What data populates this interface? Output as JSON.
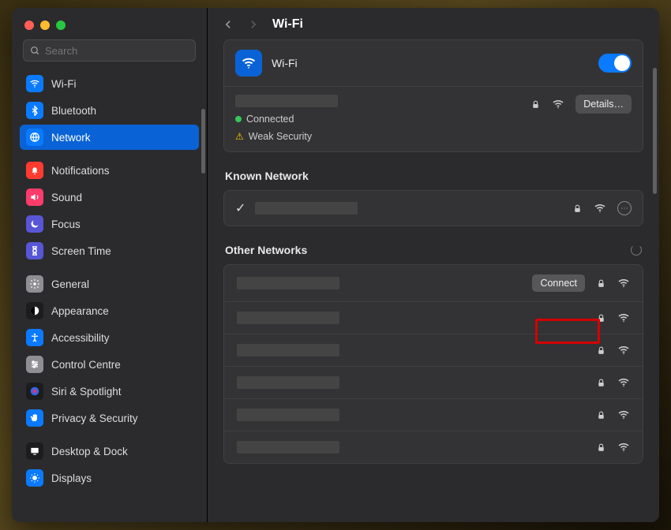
{
  "window": {
    "search_placeholder": "Search",
    "page_title": "Wi-Fi"
  },
  "sidebar": {
    "items": [
      {
        "label": "Wi-Fi",
        "icon": "wifi-icon",
        "bg": "#0a7aff"
      },
      {
        "label": "Bluetooth",
        "icon": "bluetooth-icon",
        "bg": "#0a7aff"
      },
      {
        "label": "Network",
        "icon": "globe-icon",
        "bg": "#0a7aff",
        "selected": true
      },
      {
        "gap": true
      },
      {
        "label": "Notifications",
        "icon": "bell-icon",
        "bg": "#ff3b30"
      },
      {
        "label": "Sound",
        "icon": "speaker-icon",
        "bg": "#ff3b6b"
      },
      {
        "label": "Focus",
        "icon": "moon-icon",
        "bg": "#5856d6"
      },
      {
        "label": "Screen Time",
        "icon": "hourglass-icon",
        "bg": "#5856d6"
      },
      {
        "gap": true
      },
      {
        "label": "General",
        "icon": "gear-icon",
        "bg": "#8e8e93"
      },
      {
        "label": "Appearance",
        "icon": "contrast-icon",
        "bg": "#1c1c1e"
      },
      {
        "label": "Accessibility",
        "icon": "accessibility-icon",
        "bg": "#0a7aff"
      },
      {
        "label": "Control Centre",
        "icon": "sliders-icon",
        "bg": "#8e8e93"
      },
      {
        "label": "Siri & Spotlight",
        "icon": "siri-icon",
        "bg": "#1c1c1e"
      },
      {
        "label": "Privacy & Security",
        "icon": "hand-icon",
        "bg": "#0a7aff"
      },
      {
        "gap": true
      },
      {
        "label": "Desktop & Dock",
        "icon": "desktop-icon",
        "bg": "#1c1c1e"
      },
      {
        "label": "Displays",
        "icon": "displays-icon",
        "bg": "#0a7aff"
      }
    ]
  },
  "wifi_panel": {
    "label": "Wi-Fi",
    "enabled": true,
    "details_label": "Details…",
    "status_connected": "Connected",
    "status_warning": "Weak Security"
  },
  "known": {
    "heading": "Known Network"
  },
  "other": {
    "heading": "Other Networks",
    "connect_label": "Connect",
    "rows": [
      {
        "connect_button": true
      },
      {},
      {},
      {},
      {},
      {}
    ]
  }
}
